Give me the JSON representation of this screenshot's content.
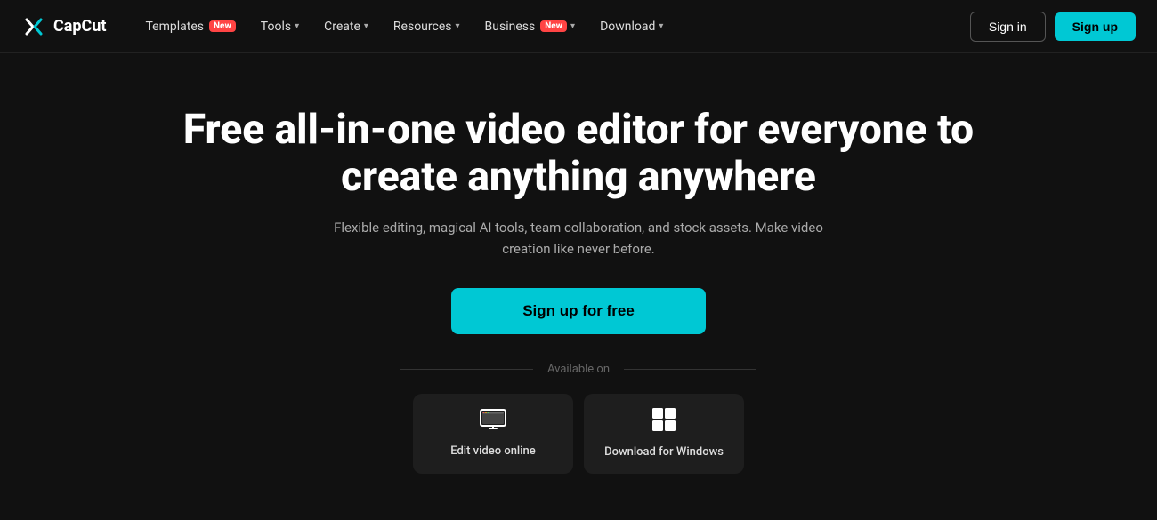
{
  "brand": {
    "name": "CapCut"
  },
  "navbar": {
    "links": [
      {
        "label": "Templates",
        "badge": "New",
        "has_chevron": false
      },
      {
        "label": "Tools",
        "badge": null,
        "has_chevron": true
      },
      {
        "label": "Create",
        "badge": null,
        "has_chevron": true
      },
      {
        "label": "Resources",
        "badge": null,
        "has_chevron": true
      },
      {
        "label": "Business",
        "badge": "New",
        "has_chevron": true
      },
      {
        "label": "Download",
        "badge": null,
        "has_chevron": true
      }
    ],
    "signin_label": "Sign in",
    "signup_label": "Sign up"
  },
  "hero": {
    "title": "Free all-in-one video editor for everyone to create anything anywhere",
    "subtitle": "Flexible editing, magical AI tools, team collaboration, and stock assets. Make video creation like never before.",
    "cta_label": "Sign up for free",
    "available_label": "Available on"
  },
  "platforms": [
    {
      "id": "online",
      "label": "Edit video online",
      "icon": "monitor"
    },
    {
      "id": "windows",
      "label": "Download for Windows",
      "icon": "windows"
    }
  ],
  "colors": {
    "accent": "#00c8d4",
    "bg": "#111111",
    "card_bg": "#1e1e1e",
    "badge_bg": "#ff4444"
  }
}
